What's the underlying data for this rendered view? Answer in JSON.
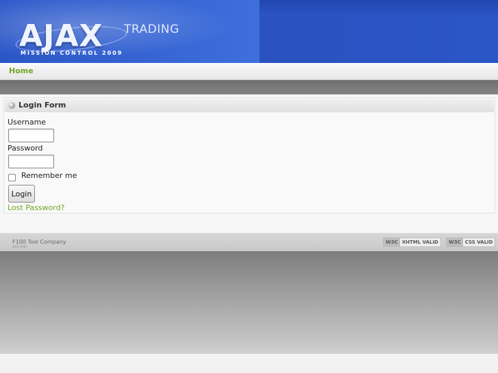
{
  "header": {
    "logo_main": "AJAX",
    "logo_side": "TRADING",
    "logo_sub": "MISSION CONTROL 2009"
  },
  "nav": {
    "home": "Home"
  },
  "login": {
    "title": "Login Form",
    "username_label": "Username",
    "username_value": "",
    "password_label": "Password",
    "password_value": "",
    "remember_label": "Remember me",
    "remember_checked": false,
    "button_label": "Login",
    "lost_password": "Lost Password?"
  },
  "footer": {
    "company": "F100 Tool Company",
    "years": "2001-2007",
    "badge1_w3c": "W3C",
    "badge1_text": "XHTML VALID",
    "badge2_w3c": "W3C",
    "badge2_text": "CSS VALID"
  },
  "colors": {
    "header_blue": "#2b56c8",
    "link_green": "#6fa526",
    "dark_bar": "#7a7a7a"
  }
}
